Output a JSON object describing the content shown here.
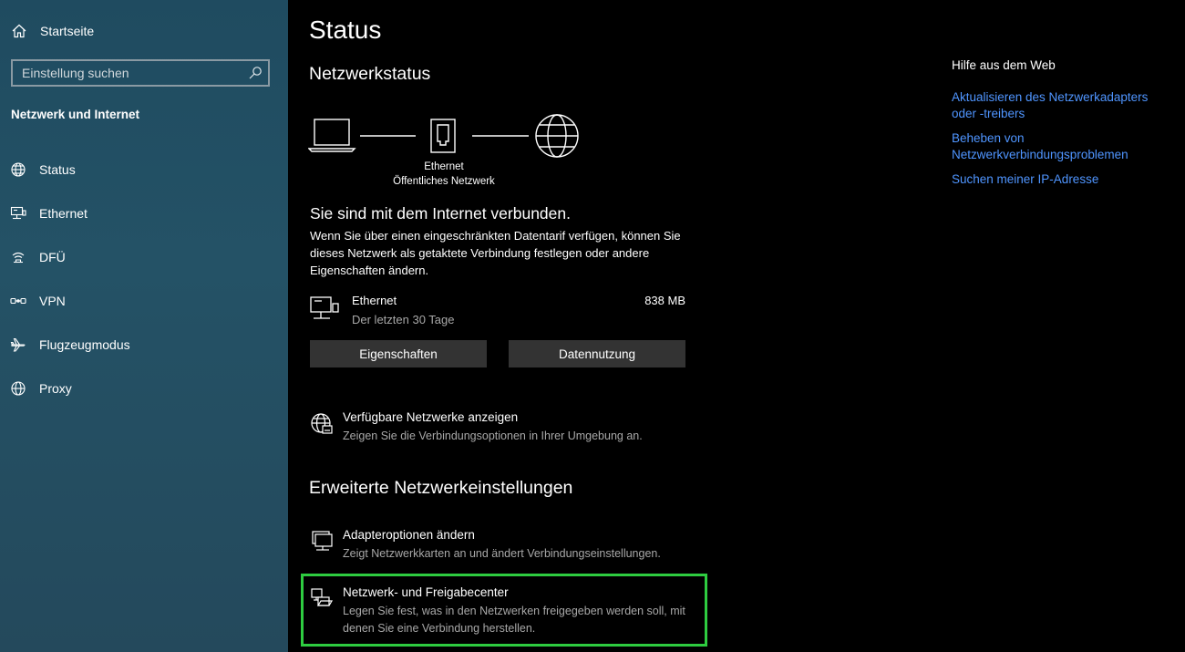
{
  "sidebar": {
    "home_label": "Startseite",
    "search_placeholder": "Einstellung suchen",
    "section_title": "Netzwerk und Internet",
    "items": [
      {
        "label": "Status",
        "icon": "globe-status-icon"
      },
      {
        "label": "Ethernet",
        "icon": "ethernet-icon"
      },
      {
        "label": "DFÜ",
        "icon": "dialup-icon"
      },
      {
        "label": "VPN",
        "icon": "vpn-icon"
      },
      {
        "label": "Flugzeugmodus",
        "icon": "airplane-icon"
      },
      {
        "label": "Proxy",
        "icon": "globe-icon"
      }
    ]
  },
  "main": {
    "title": "Status",
    "network_status_title": "Netzwerkstatus",
    "diagram": {
      "adapter_label": "Ethernet",
      "network_label": "Öffentliches Netzwerk"
    },
    "connected_text": "Sie sind mit dem Internet verbunden.",
    "description": "Wenn Sie über einen eingeschränkten Datentarif verfügen, können Sie dieses Netzwerk als getaktete Verbindung festlegen oder andere Eigenschaften ändern.",
    "connection": {
      "name": "Ethernet",
      "period": "Der letzten 30 Tage",
      "usage": "838 MB"
    },
    "buttons": {
      "properties": "Eigenschaften",
      "data_usage": "Datennutzung"
    },
    "available_networks": {
      "title": "Verfügbare Netzwerke anzeigen",
      "subtitle": "Zeigen Sie die Verbindungsoptionen in Ihrer Umgebung an."
    },
    "advanced_title": "Erweiterte Netzwerkeinstellungen",
    "adapter_options": {
      "title": "Adapteroptionen ändern",
      "subtitle": "Zeigt Netzwerkkarten an und ändert Verbindungseinstellungen."
    },
    "sharing_center": {
      "title": "Netzwerk- und Freigabecenter",
      "subtitle": "Legen Sie fest, was in den Netzwerken freigegeben werden soll, mit denen Sie eine Verbindung herstellen."
    }
  },
  "help": {
    "title": "Hilfe aus dem Web",
    "links": [
      "Aktualisieren des Netzwerkadapters oder -treibers",
      "Beheben von Netzwerkverbindungsproblemen",
      "Suchen meiner IP-Adresse"
    ]
  },
  "colors": {
    "sidebar_bg": "#245266",
    "link_blue": "#4f95ff",
    "highlight_green": "#2ecc40",
    "button_bg": "#333333"
  }
}
